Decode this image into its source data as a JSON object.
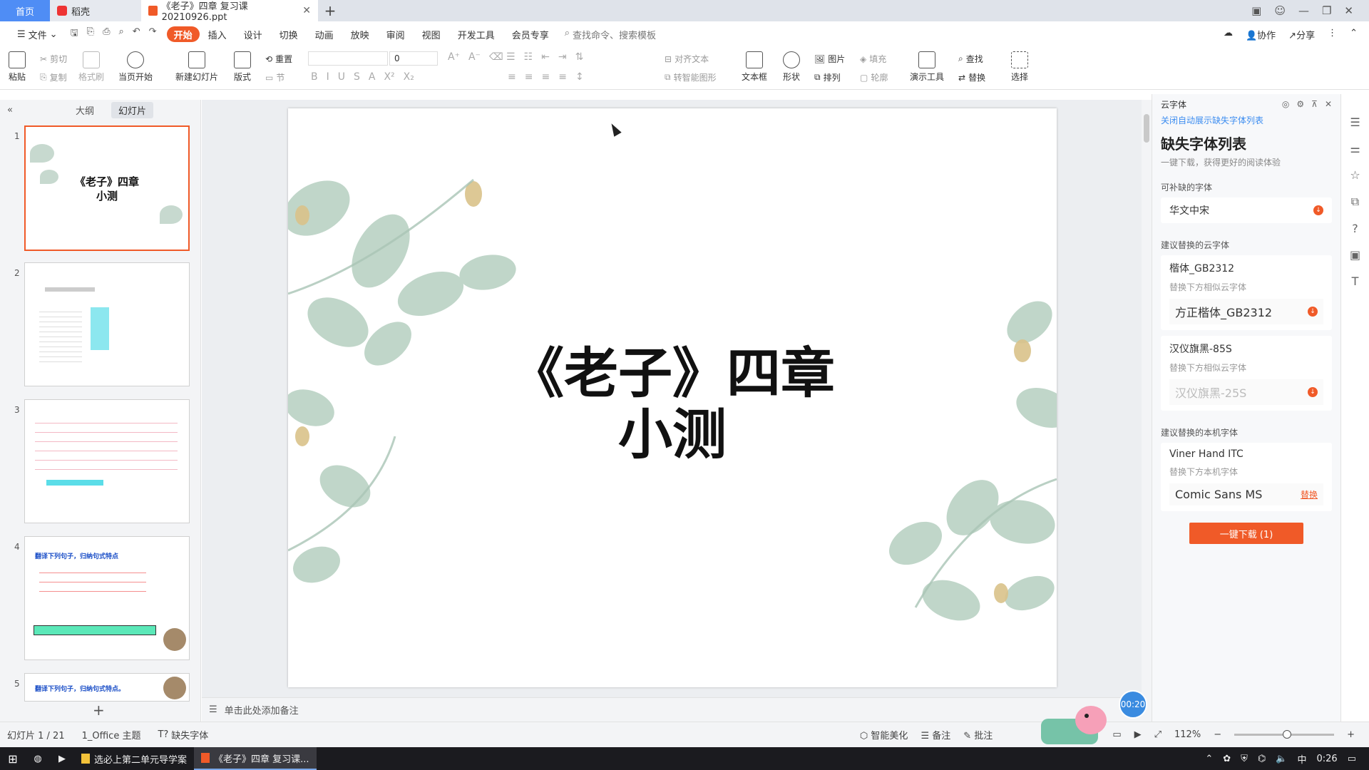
{
  "tabs": {
    "home": "首页",
    "daoke": "稻壳",
    "doc": "《老子》四章 复习课20210926.ppt"
  },
  "menu": {
    "file": "文件",
    "items": [
      "开始",
      "插入",
      "设计",
      "切换",
      "动画",
      "放映",
      "审阅",
      "视图",
      "开发工具",
      "会员专享"
    ],
    "search": "查找命令、搜索模板",
    "collab": "协作",
    "share": "分享"
  },
  "ribbon": {
    "paste": "粘贴",
    "cut": "剪切",
    "copy": "复制",
    "format_painter": "格式刷",
    "start_from_current": "当页开始",
    "new_slide": "新建幻灯片",
    "layout": "版式",
    "section": "节",
    "reset": "重置",
    "font_size": "0",
    "align_text": "对齐文本",
    "smart_shape": "转智能图形",
    "textbox": "文本框",
    "shape": "形状",
    "picture": "图片",
    "fill": "填充",
    "arrange": "排列",
    "outline": "轮廓",
    "present_tools": "演示工具",
    "find": "查找",
    "replace": "替换",
    "select": "选择"
  },
  "left_panel": {
    "outline_tab": "大纲",
    "slides_tab": "幻灯片",
    "slide_numbers": [
      "1",
      "2",
      "3",
      "4",
      "5"
    ],
    "thumb1_title_line1": "《老子》四章",
    "thumb1_title_line2": "小测",
    "thumb4_heading": "翻译下列句子，归纳句式特点",
    "thumb5_heading": "翻译下列句子，归纳句式特点。"
  },
  "slide": {
    "title_line1": "《老子》四章",
    "title_line2": "小测"
  },
  "notes_placeholder": "单击此处添加备注",
  "right_panel": {
    "panel_name": "云字体",
    "close_auto_show": "关闭自动展示缺失字体列表",
    "heading": "缺失字体列表",
    "subheading": "一键下载，获得更好的阅读体验",
    "section_available": "可补缺的字体",
    "font_available": "华文中宋",
    "section_cloud": "建议替换的云字体",
    "cloud_fonts": [
      {
        "name": "楷体_GB2312",
        "hint": "替换下方相似云字体",
        "alt": "方正楷体_GB2312",
        "dim": false
      },
      {
        "name": "汉仪旗黑-85S",
        "hint": "替换下方相似云字体",
        "alt": "汉仪旗黑-25S",
        "dim": true
      }
    ],
    "section_local": "建议替换的本机字体",
    "local_font": {
      "name": "Viner Hand ITC",
      "hint": "替换下方本机字体",
      "alt": "Comic Sans MS",
      "action": "替换"
    },
    "download_button": "一键下载 (1)"
  },
  "status": {
    "slide_info": "幻灯片 1 / 21",
    "theme": "1_Office 主题",
    "missing_fonts": "缺失字体",
    "beautify": "智能美化",
    "notes": "备注",
    "comments": "批注",
    "zoom": "112%",
    "timer": "00:20"
  },
  "taskbar": {
    "task1": "选必上第二单元导学案",
    "task2": "《老子》四章 复习课...",
    "ime": "中",
    "time": "0:26"
  },
  "colors": {
    "accent": "#f05a28",
    "link": "#3b8cf0",
    "home_tab": "#4f8df5"
  }
}
